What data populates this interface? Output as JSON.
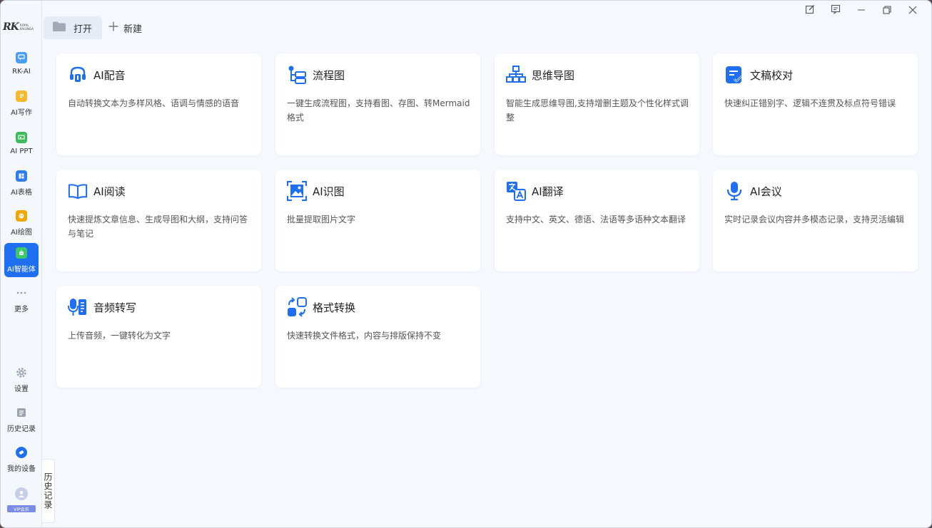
{
  "app": {
    "logo_text": "RK",
    "logo_sub": "ROYAL KALUNGA"
  },
  "sidebar": {
    "items": [
      {
        "label": "RK-AI",
        "icon": "chat-icon",
        "color": "#4a9ef5"
      },
      {
        "label": "AI写作",
        "icon": "document-icon",
        "color": "#f5b82e"
      },
      {
        "label": "AI PPT",
        "icon": "presentation-icon",
        "color": "#3dbb5c"
      },
      {
        "label": "AI表格",
        "icon": "spreadsheet-icon",
        "color": "#2f7cf0"
      },
      {
        "label": "AI绘图",
        "icon": "palette-icon",
        "color": "#f0a800"
      },
      {
        "label": "AI智能体",
        "icon": "robot-icon",
        "color": "#3bc86a",
        "active": true
      },
      {
        "label": "更多",
        "icon": "more-icon"
      }
    ],
    "bottom": [
      {
        "label": "设置",
        "icon": "gear-icon"
      },
      {
        "label": "历史记录",
        "icon": "history-icon"
      },
      {
        "label": "我的设备",
        "icon": "device-icon"
      }
    ],
    "vip": "VIP会员"
  },
  "tabs": {
    "open_label": "打开",
    "new_label": "新建"
  },
  "history_tab": "历史记录",
  "accent": "#1f6ff2",
  "cards": [
    {
      "title": "AI配音",
      "desc": "自动转换文本为多样风格、语调与情感的语音",
      "icon": "voice-icon"
    },
    {
      "title": "流程图",
      "desc": "一键生成流程图，支持看图、存图、转Mermaid格式",
      "icon": "flowchart-icon"
    },
    {
      "title": "思维导图",
      "desc": "智能生成思维导图,支持增删主题及个性化样式调整",
      "icon": "mindmap-icon"
    },
    {
      "title": "文稿校对",
      "desc": "快速纠正错别字、逻辑不连贯及标点符号错误",
      "icon": "proofread-icon"
    },
    {
      "title": "AI阅读",
      "desc": "快速提炼文章信息、生成导图和大纲，支持问答与笔记",
      "icon": "book-icon"
    },
    {
      "title": "AI识图",
      "desc": "批量提取图片文字",
      "icon": "image-scan-icon"
    },
    {
      "title": "AI翻译",
      "desc": "支持中文、英文、德语、法语等多语种文本翻译",
      "icon": "translate-icon"
    },
    {
      "title": "AI会议",
      "desc": "实时记录会议内容并多模态记录，支持灵活编辑",
      "icon": "microphone-icon"
    },
    {
      "title": "音频转写",
      "desc": "上传音频，一键转化为文字",
      "icon": "audio-transcribe-icon"
    },
    {
      "title": "格式转换",
      "desc": "快速转换文件格式，内容与排版保持不变",
      "icon": "format-convert-icon"
    }
  ]
}
